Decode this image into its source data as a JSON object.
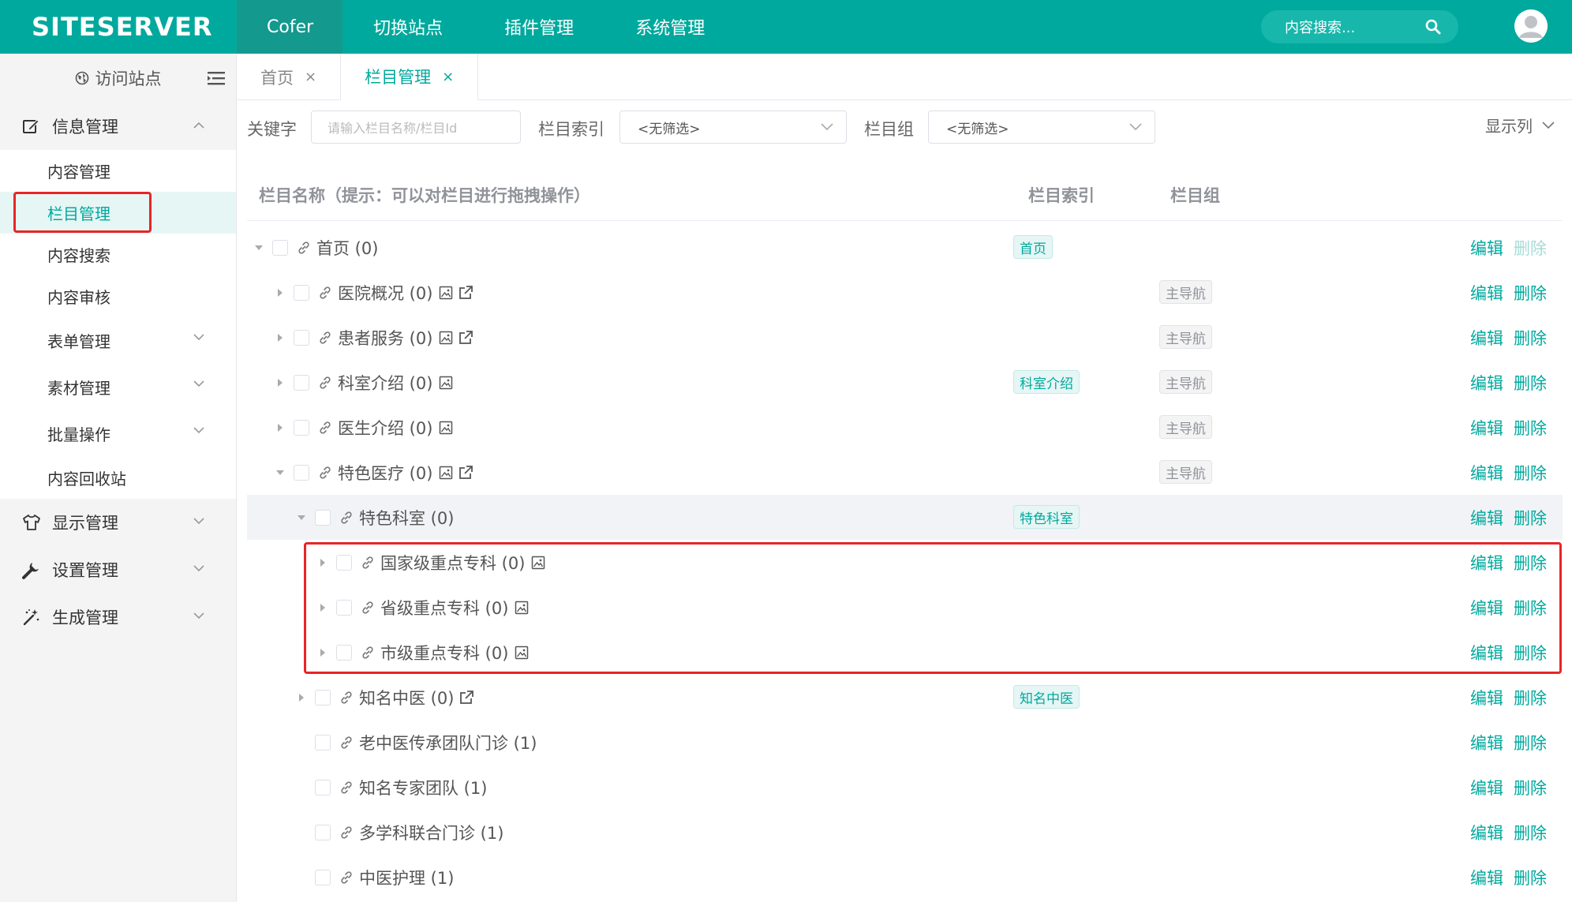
{
  "topbar": {
    "logo": "SITESERVER",
    "nav": [
      "Cofer",
      "切换站点",
      "插件管理",
      "系统管理"
    ],
    "search_placeholder": "内容搜索..."
  },
  "sidebar": {
    "visit": "访问站点",
    "group_info": "信息管理",
    "items": [
      "内容管理",
      "栏目管理",
      "内容搜索",
      "内容审核",
      "表单管理",
      "素材管理",
      "批量操作",
      "内容回收站"
    ],
    "group_display": "显示管理",
    "group_settings": "设置管理",
    "group_generate": "生成管理"
  },
  "tabs": [
    {
      "label": "首页",
      "close": "×"
    },
    {
      "label": "栏目管理",
      "close": "×"
    }
  ],
  "filters": {
    "keyword_label": "关键字",
    "keyword_placeholder": "请输入栏目名称/栏目Id",
    "index_label": "栏目索引",
    "index_value": "<无筛选>",
    "group_label": "栏目组",
    "group_value": "<无筛选>",
    "show_columns": "显示列"
  },
  "table": {
    "headers": {
      "name": "栏目名称（提示：可以对栏目进行拖拽操作）",
      "index": "栏目索引",
      "group": "栏目组"
    },
    "edit_label": "编辑",
    "delete_label": "删除",
    "rows": [
      {
        "name": "首页 (0)",
        "index": "首页",
        "group": ""
      },
      {
        "name": "医院概况 (0)",
        "index": "",
        "group": "主导航"
      },
      {
        "name": "患者服务 (0)",
        "index": "",
        "group": "主导航"
      },
      {
        "name": "科室介绍 (0)",
        "index": "科室介绍",
        "group": "主导航"
      },
      {
        "name": "医生介绍 (0)",
        "index": "",
        "group": "主导航"
      },
      {
        "name": "特色医疗 (0)",
        "index": "",
        "group": "主导航"
      },
      {
        "name": "特色科室 (0)",
        "index": "特色科室",
        "group": ""
      },
      {
        "name": "国家级重点专科 (0)",
        "index": "",
        "group": ""
      },
      {
        "name": "省级重点专科 (0)",
        "index": "",
        "group": ""
      },
      {
        "name": "市级重点专科 (0)",
        "index": "",
        "group": ""
      },
      {
        "name": "知名中医 (0)",
        "index": "知名中医",
        "group": ""
      },
      {
        "name": "老中医传承团队门诊 (1)",
        "index": "",
        "group": ""
      },
      {
        "name": "知名专家团队 (1)",
        "index": "",
        "group": ""
      },
      {
        "name": "多学科联合门诊 (1)",
        "index": "",
        "group": ""
      },
      {
        "name": "中医护理 (1)",
        "index": "",
        "group": ""
      }
    ]
  }
}
